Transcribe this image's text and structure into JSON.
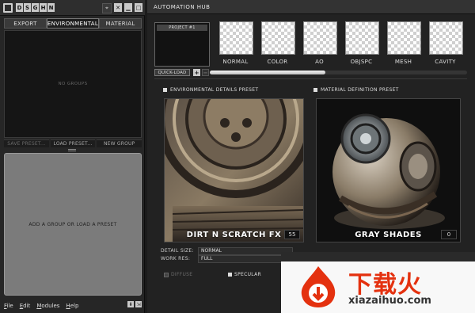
{
  "left": {
    "title_letters": [
      "D",
      "S",
      "G",
      "H",
      "N"
    ],
    "tabs": [
      "EXPORT",
      "ENVIRONMENTAL",
      "MATERIAL"
    ],
    "active_tab": "ENVIRONMENTAL",
    "group_box_text": "NO GROUPS",
    "preset_buttons": [
      "SAVE PRESET...",
      "LOAD PRESET...",
      "NEW GROUP"
    ],
    "add_group_text": "ADD A GROUP OR LOAD A PRESET",
    "menu": [
      "File",
      "Edit",
      "Modules",
      "Help"
    ]
  },
  "hub": {
    "title": "AUTOMATION HUB",
    "project_label": "PROJECT #1",
    "maps": [
      "NORMAL",
      "COLOR",
      "AO",
      "OBJSPC",
      "MESH",
      "CAVITY"
    ],
    "quick_load": "QUICK-LOAD",
    "plus": "+",
    "minus": "−",
    "progress": 0.45
  },
  "env_preset": {
    "header": "ENVIRONMENTAL DETAILS PRESET",
    "name": "DIRT N SCRATCH FX",
    "count": "55",
    "detail_size_label": "DETAIL SIZE:",
    "detail_size_value": "NORMAL",
    "work_res_label": "WORK RES:",
    "work_res_value": "FULL"
  },
  "mat_preset": {
    "header": "MATERIAL DEFINITION PRESET",
    "name": "GRAY SHADES",
    "count": "0"
  },
  "toggles": {
    "diffuse": "DIFFUSE",
    "specular": "SPECULAR"
  },
  "promo": {
    "brand": "下载火",
    "url": "xiazaihuo.com"
  },
  "colors": {
    "accent_orange": "#e4310f",
    "panel_bg": "#222222"
  }
}
